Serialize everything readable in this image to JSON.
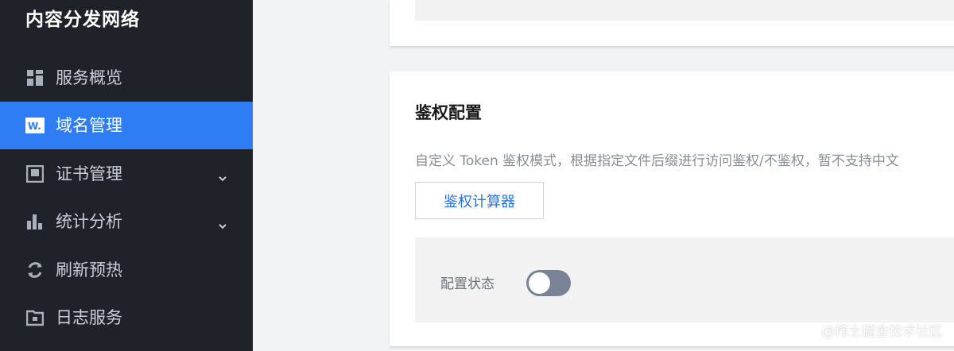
{
  "sidebar": {
    "title": "内容分发网络",
    "items": [
      {
        "label": "服务概览",
        "icon": "grid-icon",
        "active": false,
        "expandable": false
      },
      {
        "label": "域名管理",
        "icon": "domain-icon",
        "active": true,
        "expandable": false
      },
      {
        "label": "证书管理",
        "icon": "certificate-icon",
        "active": false,
        "expandable": true
      },
      {
        "label": "统计分析",
        "icon": "bar-chart-icon",
        "active": false,
        "expandable": true
      },
      {
        "label": "刷新预热",
        "icon": "refresh-icon",
        "active": false,
        "expandable": false
      },
      {
        "label": "日志服务",
        "icon": "folder-icon",
        "active": false,
        "expandable": false
      }
    ]
  },
  "auth_card": {
    "title": "鉴权配置",
    "description": "自定义 Token 鉴权模式，根据指定文件后缀进行访问鉴权/不鉴权，暂不支持中文",
    "calculator_button": "鉴权计算器",
    "status_label": "配置状态",
    "status_enabled": false
  },
  "watermark": "@稀土掘金技术社区",
  "colors": {
    "sidebar_bg": "#1f2329",
    "active_bg": "#2f7df5",
    "link_blue": "#2f6fd6",
    "toggle_off": "#7a8395"
  }
}
